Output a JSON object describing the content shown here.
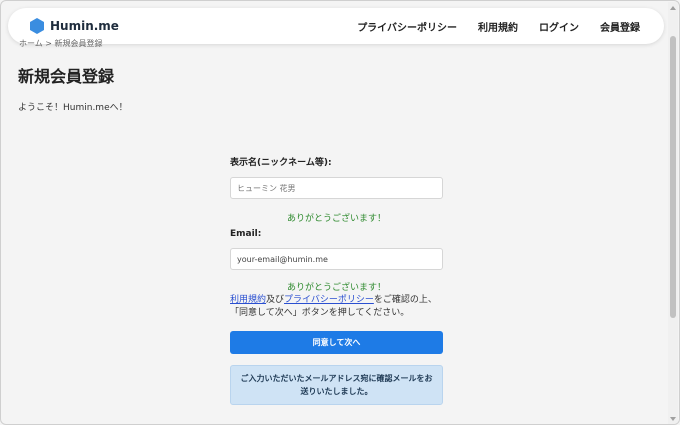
{
  "brand": {
    "name": "Humin.me",
    "icon": "hexagon-logo-icon",
    "color": "#3a8de0"
  },
  "nav": {
    "links": [
      {
        "label": "プライバシーポリシー"
      },
      {
        "label": "利用規約"
      },
      {
        "label": "ログイン"
      },
      {
        "label": "会員登録"
      }
    ]
  },
  "breadcrumb": "ホーム > 新規会員登録",
  "page": {
    "title": "新規会員登録",
    "welcome": "ようこそ！Humin.meへ！"
  },
  "form": {
    "nickname": {
      "label": "表示名(ニックネーム等):",
      "placeholder": "ヒューミン 花男",
      "success": "ありがとうございます！"
    },
    "email": {
      "label": "Email:",
      "value": "your-email@humin.me",
      "success": "ありがとうございます！"
    },
    "terms": {
      "link1": "利用規約",
      "and": "及び",
      "link2": "プライバシーポリシー",
      "rest": "をご確認の上、「同意して次へ」ボタンを押してください。"
    },
    "submit_label": "同意して次へ",
    "notice": "ご入力いただいたメールアドレス宛に確認メールをお送りいたしました。"
  },
  "colors": {
    "accent": "#1e7be6",
    "success": "#2e8a2e",
    "notice_bg": "#cfe3f5",
    "link": "#2a4fd0"
  }
}
